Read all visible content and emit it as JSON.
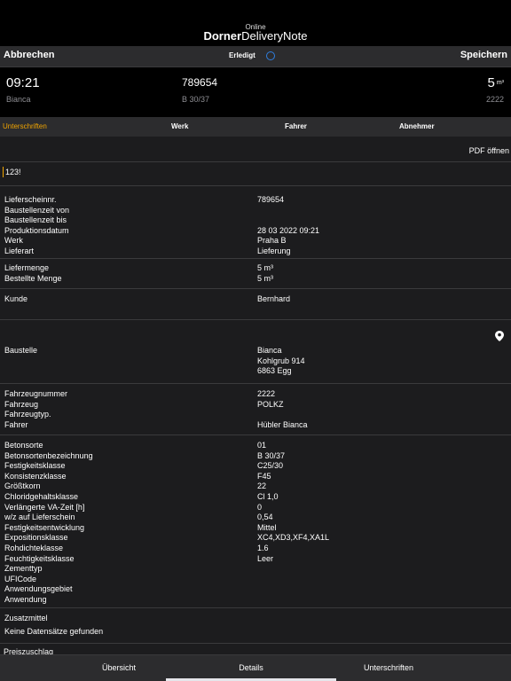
{
  "header": {
    "online_label": "Online",
    "app_title_bold": "Dorner",
    "app_title_rest": "DeliveryNote"
  },
  "toolbar": {
    "cancel_label": "Abbrechen",
    "done_label": "Erledigt",
    "save_label": "Speichern"
  },
  "summary": {
    "time": "09:21",
    "name": "Bianca",
    "delivery_no": "789654",
    "concrete_sort": "B 30/37",
    "volume": "5",
    "volume_unit": "m³",
    "vehicle_no": "2222"
  },
  "tabs": [
    "Unterschriften",
    "Werk",
    "Fahrer",
    "Abnehmer"
  ],
  "pdf_label": "PDF öffnen",
  "note": "123!",
  "section1": [
    {
      "k": "Lieferscheinnr.",
      "v": "789654"
    },
    {
      "k": "Baustellenzeit von",
      "v": ""
    },
    {
      "k": "Baustellenzeit bis",
      "v": ""
    },
    {
      "k": "Produktionsdatum",
      "v": "28 03 2022 09:21"
    },
    {
      "k": "Werk",
      "v": "Praha B"
    },
    {
      "k": "Lieferart",
      "v": "Lieferung"
    }
  ],
  "section2": [
    {
      "k": "Liefermenge",
      "v": "5 m³"
    },
    {
      "k": "Bestellte Menge",
      "v": "5 m³"
    }
  ],
  "section3": [
    {
      "k": "Kunde",
      "v": "Bernhard"
    }
  ],
  "section4": [
    {
      "k": "Baustelle",
      "v": "Bianca"
    },
    {
      "k": "",
      "v": "Kohlgrub 914"
    },
    {
      "k": "",
      "v": "6863 Egg"
    }
  ],
  "section5": [
    {
      "k": "Fahrzeugnummer",
      "v": "2222"
    },
    {
      "k": "Fahrzeug",
      "v": "POLKZ"
    },
    {
      "k": "Fahrzeugtyp.",
      "v": ""
    },
    {
      "k": "Fahrer",
      "v": "Hübler Bianca"
    }
  ],
  "section6": [
    {
      "k": "Betonsorte",
      "v": "01"
    },
    {
      "k": "Betonsortenbezeichnung",
      "v": "B 30/37"
    },
    {
      "k": "Festigkeitsklasse",
      "v": "C25/30"
    },
    {
      "k": "Konsistenzklasse",
      "v": "F45"
    },
    {
      "k": "Größtkorn",
      "v": "22"
    },
    {
      "k": "Chloridgehaltsklasse",
      "v": "Cl 1,0"
    },
    {
      "k": "Verlängerte VA-Zeit [h]",
      "v": "0"
    },
    {
      "k": "w/z auf Lieferschein",
      "v": "0,54"
    },
    {
      "k": "Festigkeitsentwicklung",
      "v": "Mittel"
    },
    {
      "k": "Expositionsklasse",
      "v": "XC4,XD3,XF4,XA1L"
    },
    {
      "k": "Rohdichteklasse",
      "v": "1.6"
    },
    {
      "k": "Feuchtigkeitsklasse",
      "v": "Leer"
    },
    {
      "k": "Zementtyp",
      "v": ""
    },
    {
      "k": "UFICode",
      "v": ""
    },
    {
      "k": "Anwendungsgebiet",
      "v": ""
    },
    {
      "k": "Anwendung",
      "v": ""
    }
  ],
  "additives": {
    "title": "Zusatzmittel",
    "empty": "Keine Datensätze gefunden"
  },
  "surcharge": {
    "title": "Preiszuschlag"
  },
  "bottom_tabs": [
    "Übersicht",
    "Details",
    "Unterschriften"
  ]
}
